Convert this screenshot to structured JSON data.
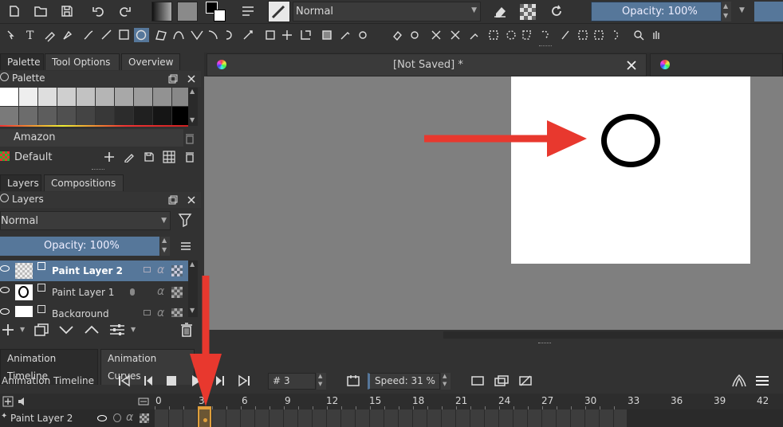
{
  "toolbar": {
    "blend_mode": "Normal",
    "opacity_label": "Opacity: 100%"
  },
  "document_tab": {
    "title": "[Not Saved]  *"
  },
  "left_tabs": {
    "palette_tab": "Palette",
    "tool_options_tab": "Tool Options",
    "overview_tab": "Overview"
  },
  "palette": {
    "header": "Palette",
    "palette_name": "Amazon",
    "set_name": "Default"
  },
  "layers_tabs": {
    "layers_tab": "Layers",
    "compositions_tab": "Compositions"
  },
  "layers": {
    "header": "Layers",
    "blend_mode": "Normal",
    "opacity_label": "Opacity:  100%",
    "items": [
      {
        "name": "Paint Layer 2",
        "selected": true
      },
      {
        "name": "Paint Layer 1",
        "selected": false
      },
      {
        "name": "Background",
        "selected": false
      }
    ]
  },
  "timeline_tabs": {
    "animation_timeline_tab": "Animation Timeline",
    "animation_curves_tab": "Animation Curves"
  },
  "timeline": {
    "title": "Animation Timeline",
    "frame_prefix": "#",
    "current_frame": "3",
    "speed_label": "Speed: 31 %",
    "frame_numbers": [
      "0",
      "3",
      "6",
      "9",
      "12",
      "15",
      "18",
      "21",
      "24",
      "27",
      "30",
      "33",
      "36",
      "39",
      "42"
    ],
    "layer_name": "Paint Layer 2"
  },
  "colors": {
    "accent": "#56779a",
    "arrow": "#e8382e",
    "keyframe": "#e0a03c"
  }
}
